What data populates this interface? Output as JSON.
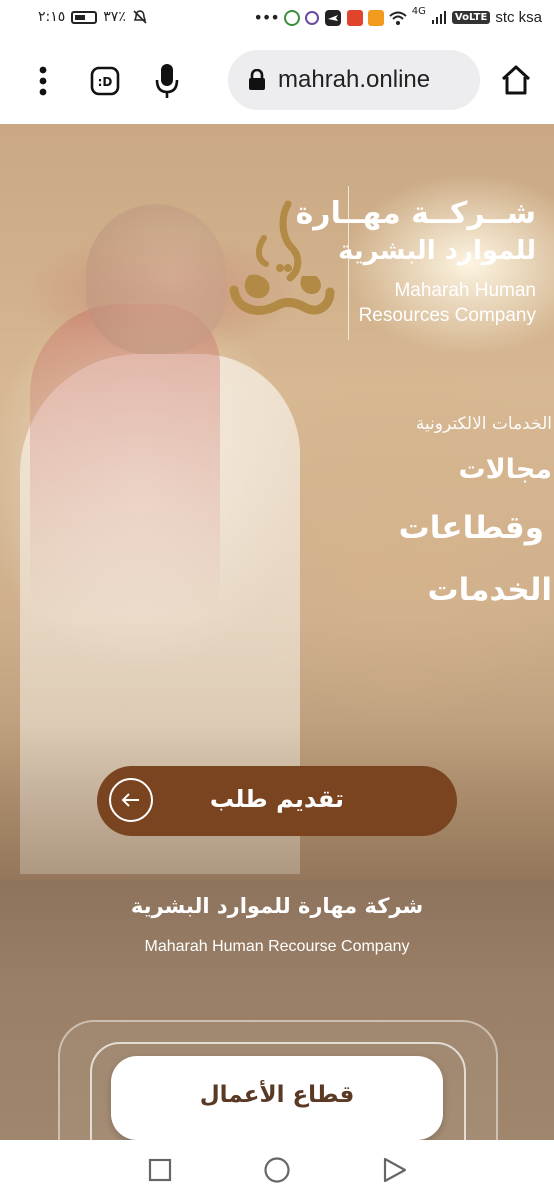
{
  "status_bar": {
    "time": "٢:١٥",
    "battery": "٣٧٪",
    "network": "4G",
    "volte": "VoLTE",
    "carrier": "stc ksa",
    "icons": [
      "mute-icon",
      "more-dots-icon",
      "app-icon",
      "app-icon",
      "airplane-app-icon",
      "mail-app-icon",
      "play-app-icon",
      "wifi-icon",
      "signal-icon"
    ]
  },
  "browser": {
    "url": "mahrah.online",
    "icons": [
      "menu-icon",
      "bitmoji-icon",
      "mic-icon",
      "lock-icon",
      "home-icon"
    ]
  },
  "hero": {
    "brand_ar_line1": "شــركــة مهــارة",
    "brand_ar_line2": "للموارد البشرية",
    "brand_en_line1": "Maharah Human",
    "brand_en_line2": "Resources Company",
    "eservices": "الخدمات الالكترونية",
    "headline_line1": "مجالات",
    "headline_line2": "وقطاعات",
    "headline_line3": "الخدمات",
    "apply_label": "تقديم طلب"
  },
  "company": {
    "name_ar": "شركة مهارة للموارد البشرية",
    "name_en": "Maharah Human Recourse Company"
  },
  "sector": {
    "label": "قطاع الأعمال"
  },
  "colors": {
    "accent_brown": "#7a4420",
    "logo_gold": "#b28a45"
  }
}
